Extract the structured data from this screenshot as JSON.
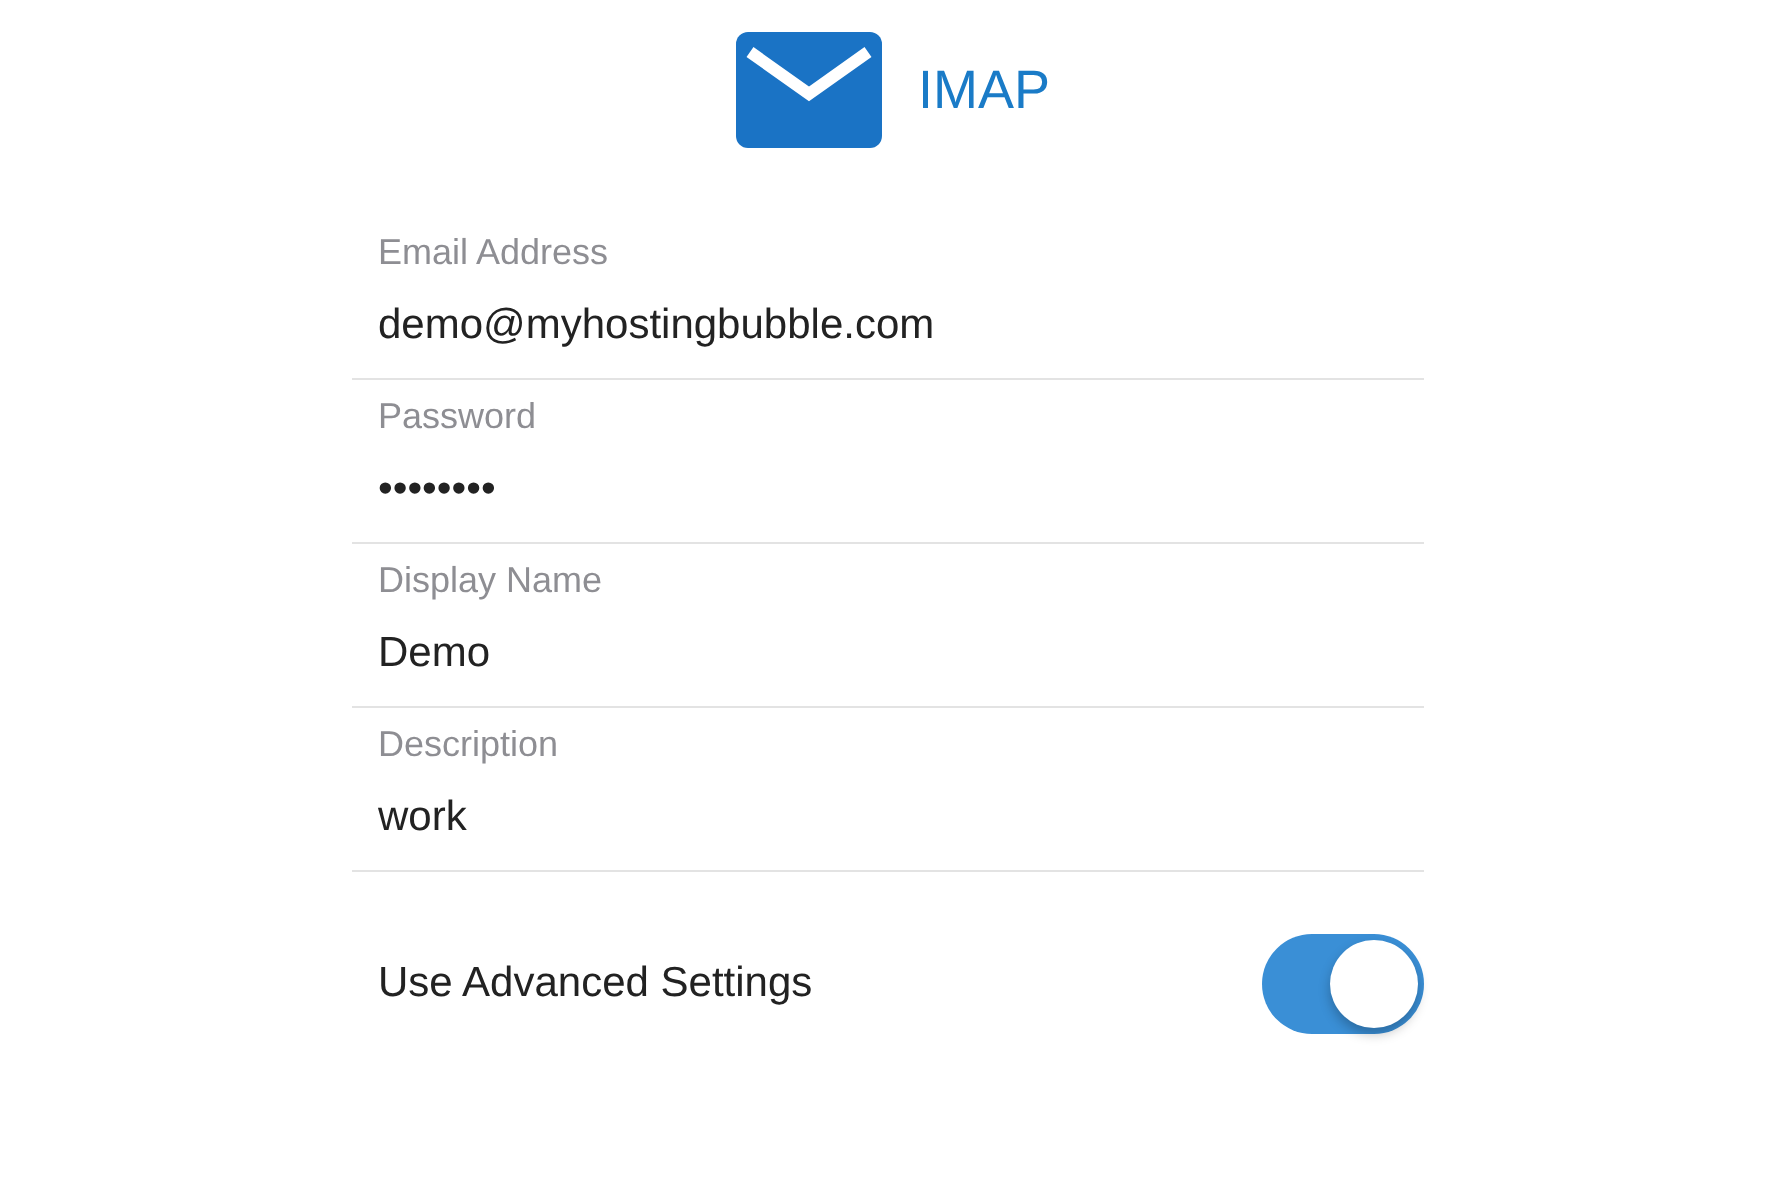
{
  "header": {
    "title": "IMAP"
  },
  "fields": [
    {
      "label": "Email Address",
      "value": "demo@myhostingbubble.com"
    },
    {
      "label": "Password",
      "value": "••••••••"
    },
    {
      "label": "Display Name",
      "value": "Demo"
    },
    {
      "label": "Description",
      "value": "work"
    }
  ],
  "advanced": {
    "label": "Use Advanced Settings",
    "on": true
  }
}
